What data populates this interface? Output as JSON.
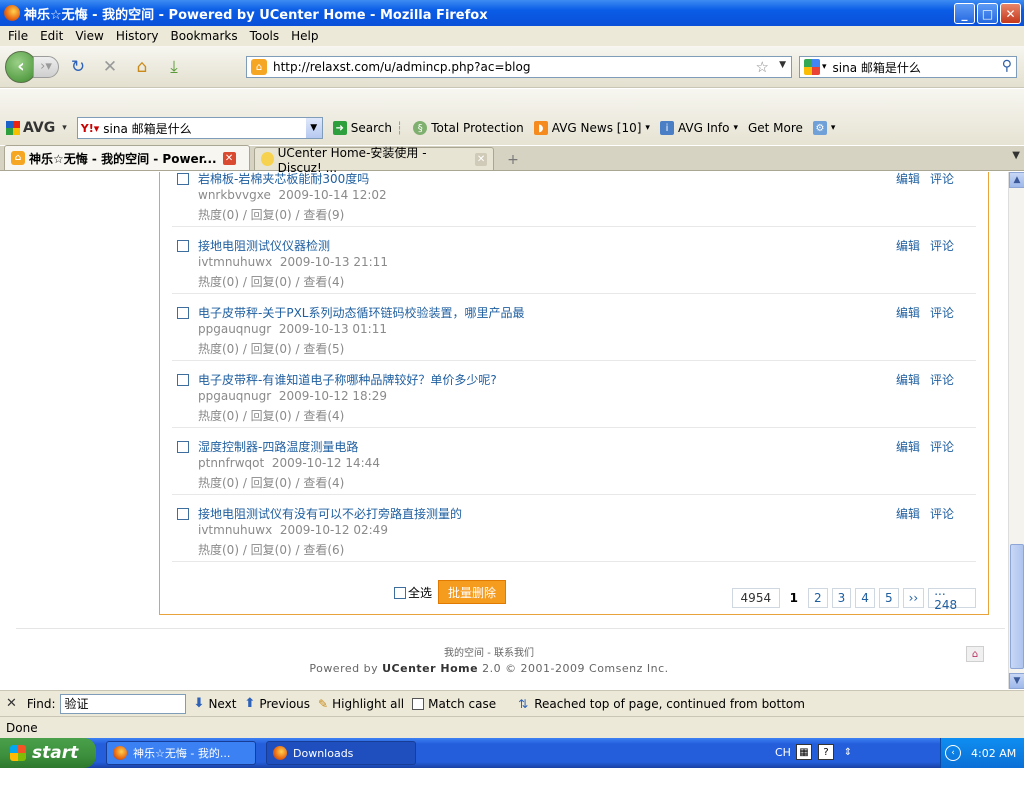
{
  "window": {
    "title": "神乐☆无悔 - 我的空间 - Powered by UCenter Home - Mozilla Firefox",
    "buttons": {
      "minimize": "_",
      "maximize": "□",
      "close": "✕"
    }
  },
  "menu": [
    "File",
    "Edit",
    "View",
    "History",
    "Bookmarks",
    "Tools",
    "Help"
  ],
  "nav": {
    "url": "http://relaxst.com/u/admincp.php?ac=blog",
    "search_value": "sina 邮箱是什么"
  },
  "avg_toolbar": {
    "logo": "AVG",
    "yahoo_query": "sina 邮箱是什么",
    "items": [
      "Search",
      "Total Protection",
      "AVG News [10]",
      "AVG Info",
      "Get More"
    ]
  },
  "tabs": [
    {
      "label": "神乐☆无悔 - 我的空间 - Power...",
      "active": true
    },
    {
      "label": "UCenter Home-安装使用 - Discuz! ...",
      "active": false
    }
  ],
  "blog": {
    "items": [
      {
        "title": "岩棉板-岩棉夹芯板能耐300度吗",
        "user": "wnrkbvvgxe",
        "time": "2009-10-14 12:02",
        "stats": "热度(0) / 回复(0) / 查看(9)"
      },
      {
        "title": "接地电阻测试仪仪器检测",
        "user": "ivtmnuhuwx",
        "time": "2009-10-13 21:11",
        "stats": "热度(0) / 回复(0) / 查看(4)"
      },
      {
        "title": "电子皮带秤-关于PXL系列动态循环链码校验装置，哪里产品最",
        "user": "ppgauqnugr",
        "time": "2009-10-13 01:11",
        "stats": "热度(0) / 回复(0) / 查看(5)"
      },
      {
        "title": "电子皮带秤-有谁知道电子称哪种品牌较好？单价多少呢?",
        "user": "ppgauqnugr",
        "time": "2009-10-12 18:29",
        "stats": "热度(0) / 回复(0) / 查看(4)"
      },
      {
        "title": "湿度控制器-四路温度测量电路",
        "user": "ptnnfrwqot",
        "time": "2009-10-12 14:44",
        "stats": "热度(0) / 回复(0) / 查看(4)"
      },
      {
        "title": "接地电阻测试仪有没有可以不必打旁路直接测量的",
        "user": "ivtmnuhuwx",
        "time": "2009-10-12 02:49",
        "stats": "热度(0) / 回复(0) / 查看(6)"
      }
    ],
    "action_edit": "编辑",
    "action_comment": "评论",
    "select_all": "全选",
    "batch_delete": "批量删除",
    "pager": {
      "total": "4954",
      "current": "1",
      "pages": [
        "2",
        "3",
        "4",
        "5"
      ],
      "next": "››",
      "last": "... 248"
    }
  },
  "footer": {
    "links": "我的空间 - 联系我们",
    "powered_prefix": "Powered by ",
    "powered_brand": "UCenter Home",
    "powered_suffix": " 2.0 © 2001-2009 Comsenz Inc."
  },
  "findbar": {
    "label": "Find:",
    "value": "验证",
    "next": "Next",
    "previous": "Previous",
    "highlight": "Highlight all",
    "match_case": "Match case",
    "message": "Reached top of page, continued from bottom"
  },
  "status": "Done",
  "taskbar": {
    "start": "start",
    "tasks": [
      "神乐☆无悔 - 我的...",
      "Downloads"
    ],
    "lang": "CH",
    "clock": "4:02 AM"
  }
}
